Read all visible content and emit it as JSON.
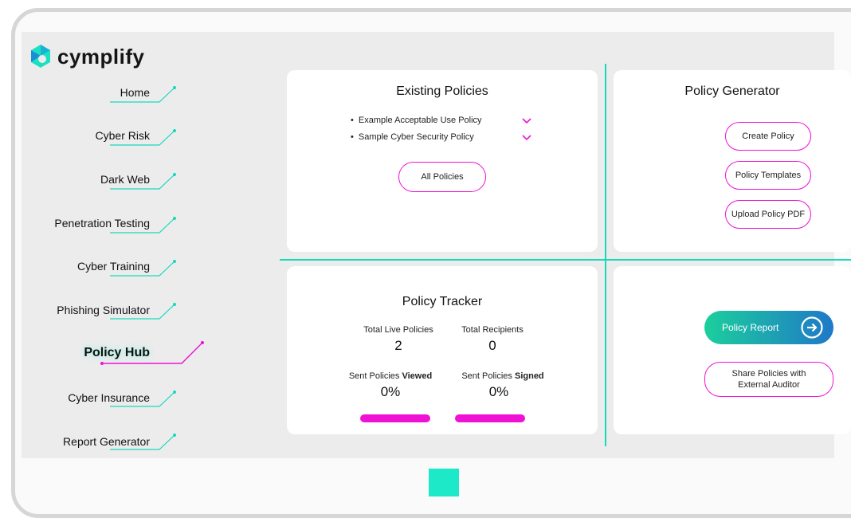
{
  "brand": {
    "name": "cymplify"
  },
  "sidebar": {
    "items": [
      {
        "label": "Home",
        "active": false
      },
      {
        "label": "Cyber Risk",
        "active": false
      },
      {
        "label": "Dark Web",
        "active": false
      },
      {
        "label": "Penetration Testing",
        "active": false
      },
      {
        "label": "Cyber Training",
        "active": false
      },
      {
        "label": "Phishing Simulator",
        "active": false
      },
      {
        "label": "Policy Hub",
        "active": true
      },
      {
        "label": "Cyber Insurance",
        "active": false
      },
      {
        "label": "Report Generator",
        "active": false
      }
    ]
  },
  "existing_policies": {
    "title": "Existing Policies",
    "items": [
      "Example Acceptable Use Policy",
      "Sample Cyber Security Policy"
    ],
    "bullet": "•",
    "all_button": "All Policies"
  },
  "policy_generator": {
    "title": "Policy Generator",
    "buttons": [
      "Create Policy",
      "Policy Templates",
      "Upload Policy PDF"
    ]
  },
  "policy_tracker": {
    "title": "Policy Tracker",
    "total_live_label": "Total Live Policies",
    "total_live_value": "2",
    "total_recipients_label": "Total Recipients",
    "total_recipients_value": "0",
    "viewed_label_prefix": "Sent Policies ",
    "viewed_label_strong": "Viewed",
    "viewed_value": "0%",
    "signed_label_prefix": "Sent Policies ",
    "signed_label_strong": "Signed",
    "signed_value": "0%"
  },
  "reports": {
    "policy_report": "Policy Report",
    "share_line1": "Share Policies with",
    "share_line2": "External Auditor"
  },
  "colors": {
    "accent_teal": "#18d9bb",
    "accent_magenta": "#f012d4",
    "report_gradient_start": "#1ccf9c",
    "report_gradient_end": "#1f78c8"
  },
  "icons": {
    "logo": "cymplify-logo-icon",
    "chevron": "chevron-down-icon",
    "arrow": "arrow-right-circle-icon"
  }
}
